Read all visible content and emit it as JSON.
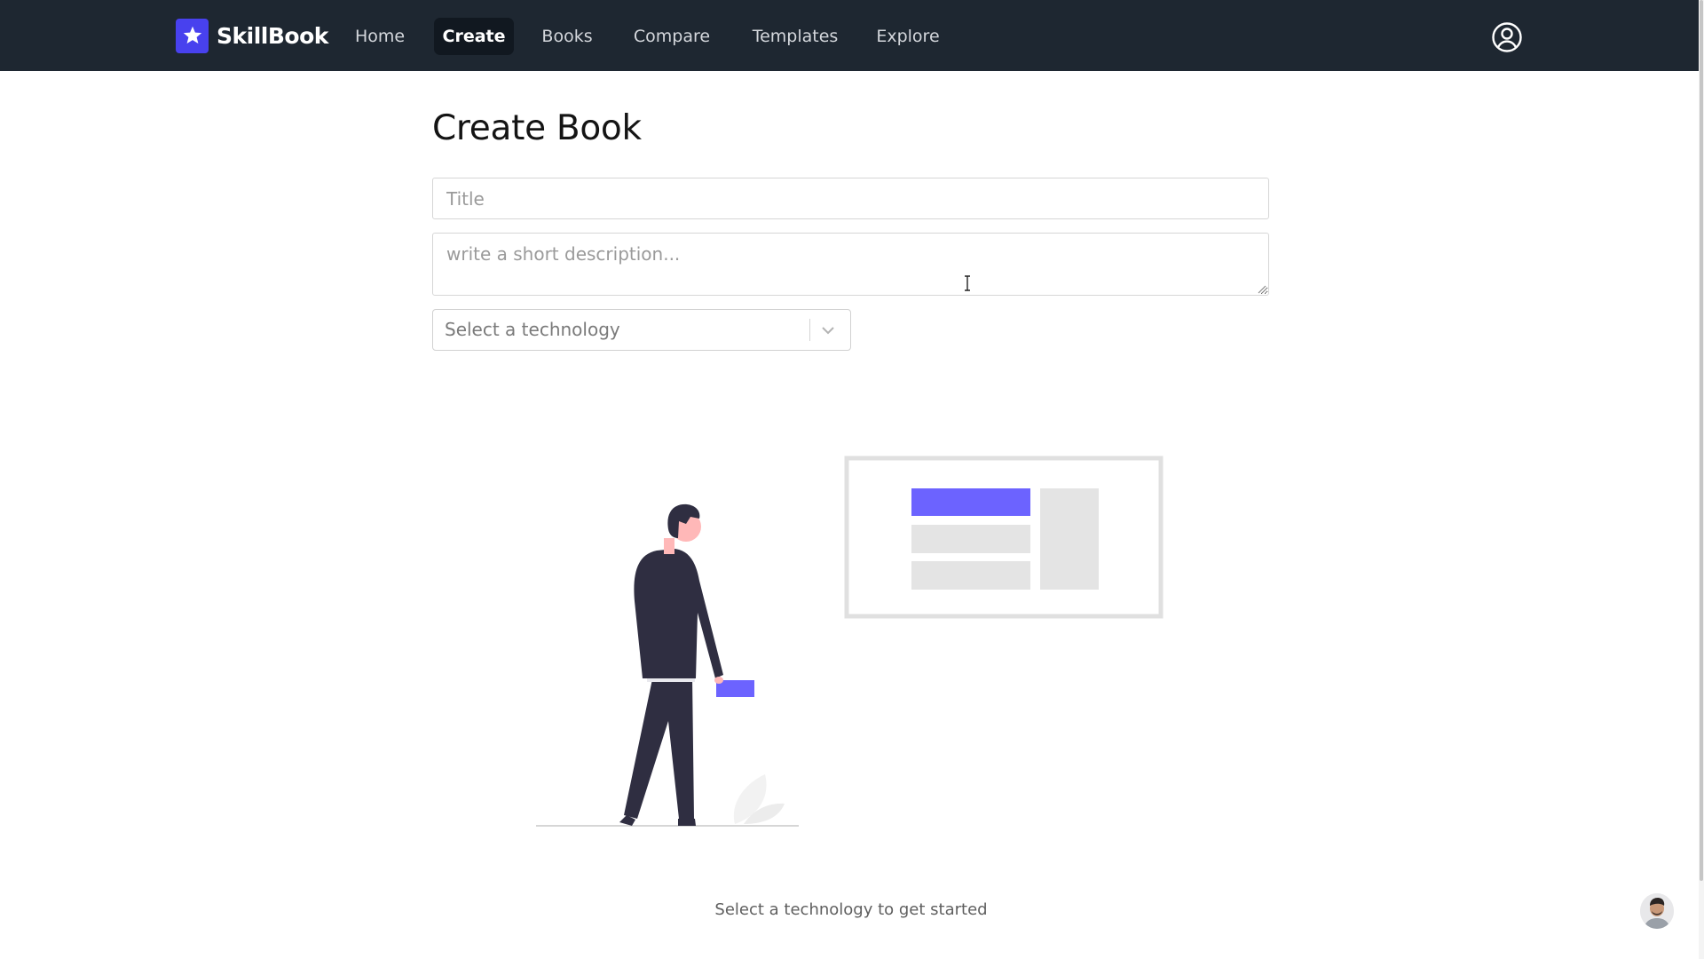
{
  "brand": {
    "name": "SkillBook",
    "icon": "star-icon",
    "color": "#4841ee"
  },
  "nav": {
    "items": [
      {
        "label": "Home",
        "active": false
      },
      {
        "label": "Create",
        "active": true
      },
      {
        "label": "Books",
        "active": false
      },
      {
        "label": "Compare",
        "active": false
      },
      {
        "label": "Templates",
        "active": false
      },
      {
        "label": "Explore",
        "active": false
      }
    ],
    "account_icon": "user-circle-icon",
    "background": "#1e2731"
  },
  "form": {
    "heading": "Create Book",
    "title_input": {
      "placeholder": "Title",
      "value": ""
    },
    "description": {
      "placeholder": "write a short description...",
      "value": ""
    },
    "technology_select": {
      "placeholder": "Select a technology",
      "icon": "chevron-down-icon"
    }
  },
  "empty_state": {
    "illustration": "person-with-layout-illustration",
    "accent": "#6c63ff",
    "message": "Select a technology to get started"
  },
  "presenter": {
    "icon": "presenter-avatar"
  }
}
